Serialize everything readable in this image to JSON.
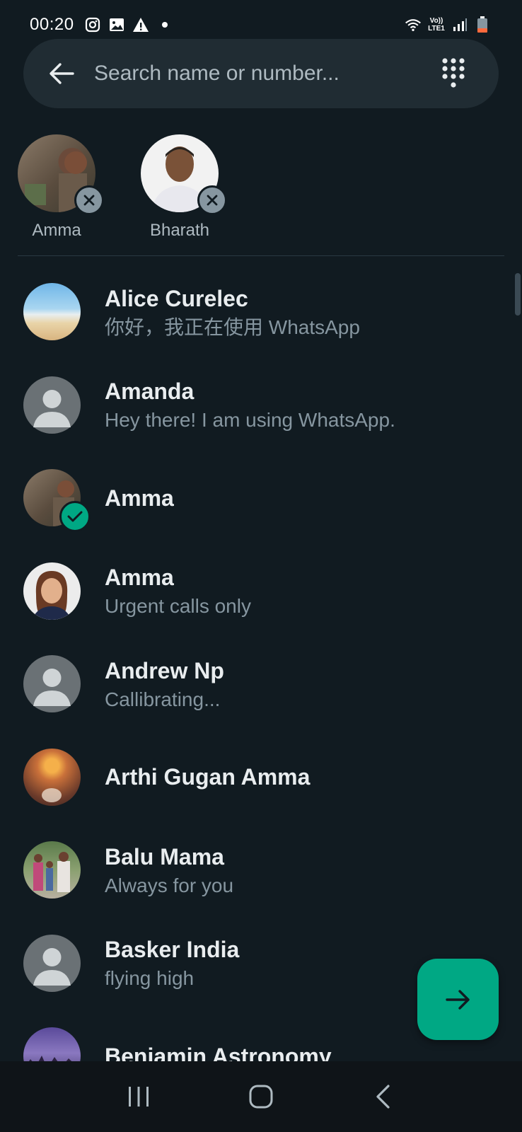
{
  "status_bar": {
    "time": "00:20",
    "icons_left": [
      "instagram-icon",
      "gallery-icon",
      "warning-icon",
      "dot-icon"
    ],
    "icons_right": [
      "wifi-icon",
      "volte-icon",
      "signal-icon",
      "battery-icon"
    ],
    "volte_text": "Vo)) LTE1"
  },
  "search": {
    "placeholder": "Search name or number..."
  },
  "selected": [
    {
      "label": "Amma"
    },
    {
      "label": "Bharath"
    }
  ],
  "contacts": [
    {
      "name": "Alice Curelec",
      "status": "你好，我正在使用 WhatsApp"
    },
    {
      "name": "Amanda",
      "status": "Hey there! I am using WhatsApp."
    },
    {
      "name": "Amma",
      "status": "",
      "selected": true
    },
    {
      "name": "Amma",
      "status": "Urgent calls only"
    },
    {
      "name": "Andrew Np",
      "status": "Callibrating..."
    },
    {
      "name": "Arthi Gugan Amma",
      "status": ""
    },
    {
      "name": "Balu Mama",
      "status": "Always for you"
    },
    {
      "name": "Basker India",
      "status": "flying high"
    },
    {
      "name": "Benjamin Astronomy",
      "status": ""
    }
  ],
  "colors": {
    "background": "#111b21",
    "accent": "#00a884",
    "search_bg": "#202c33"
  }
}
